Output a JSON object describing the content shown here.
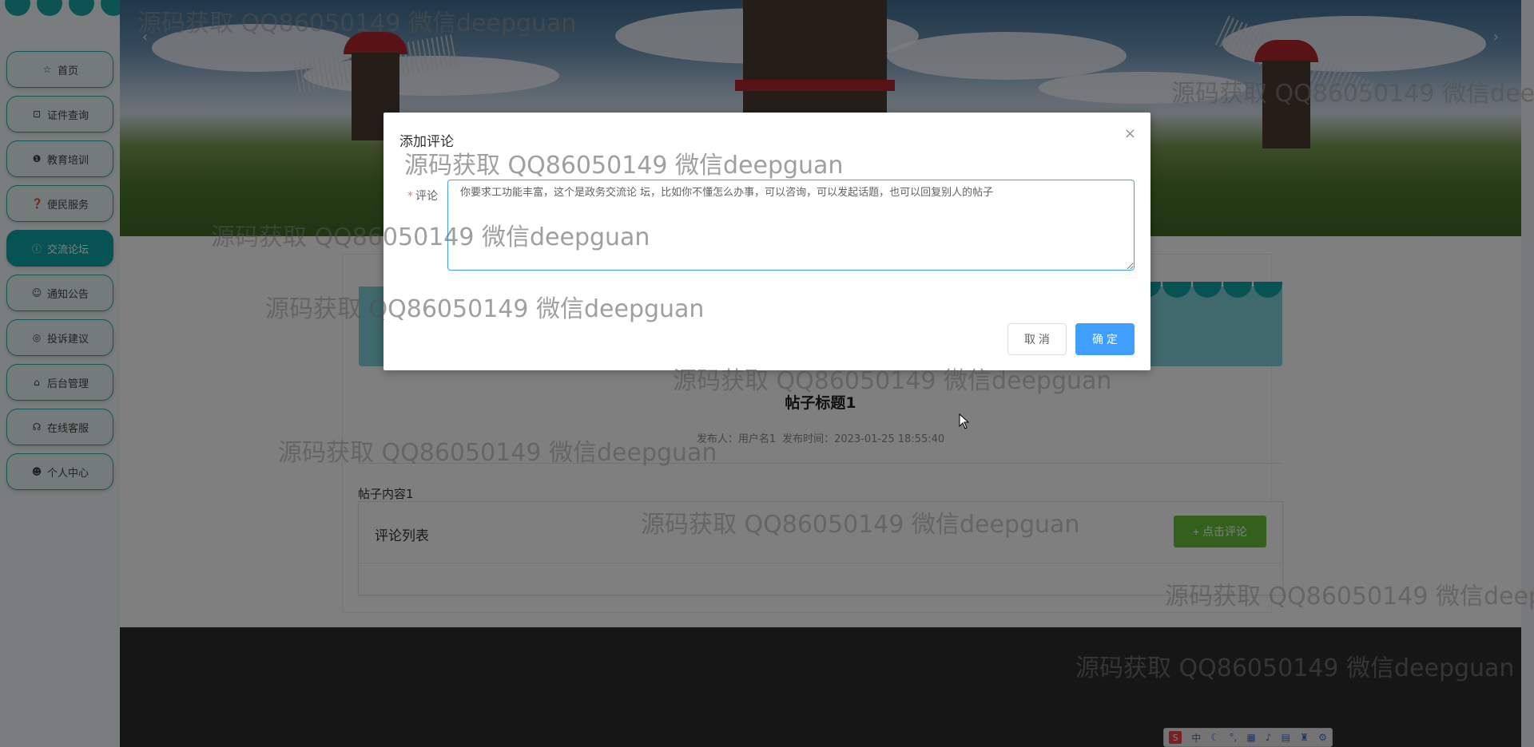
{
  "sidebar": {
    "items": [
      {
        "label": "首页",
        "icon": "star-icon",
        "glyph": "☆"
      },
      {
        "label": "证件查询",
        "icon": "bag-icon",
        "glyph": "⊡"
      },
      {
        "label": "教育培训",
        "icon": "info-icon",
        "glyph": "❶"
      },
      {
        "label": "便民服务",
        "icon": "question-icon",
        "glyph": "❓"
      },
      {
        "label": "交流论坛",
        "icon": "info-circle-icon",
        "glyph": "ⓘ"
      },
      {
        "label": "通知公告",
        "icon": "smile-icon",
        "glyph": "☺"
      },
      {
        "label": "投诉建议",
        "icon": "target-icon",
        "glyph": "◎"
      },
      {
        "label": "后台管理",
        "icon": "home-icon",
        "glyph": "⌂"
      },
      {
        "label": "在线客服",
        "icon": "headset-icon",
        "glyph": "☊"
      },
      {
        "label": "个人中心",
        "icon": "user-icon",
        "glyph": "☻"
      }
    ],
    "active_index": 4
  },
  "banner": {
    "prev_arrow": "‹",
    "next_arrow": "›"
  },
  "post": {
    "title": "帖子标题1",
    "author_label": "发布人：用户名1",
    "time_label": "发布时间：2023-01-25 18:55:40",
    "content": "帖子内容1"
  },
  "comments": {
    "title": "评论列表",
    "add_button": "+ 点击评论"
  },
  "dialog": {
    "title": "添加评论",
    "close": "×",
    "field_label": "评论",
    "required_mark": "*",
    "textarea_value": "你要求工功能丰富，这个是政务交流论 坛，比如你不懂怎么办事，可以咨询，可以发起话题，也可以回复别人的帖子",
    "cancel": "取 消",
    "confirm": "确 定"
  },
  "ime": {
    "logo": "S",
    "mode": "中"
  },
  "watermark": "源码获取 QQ86050149 微信deepguan"
}
